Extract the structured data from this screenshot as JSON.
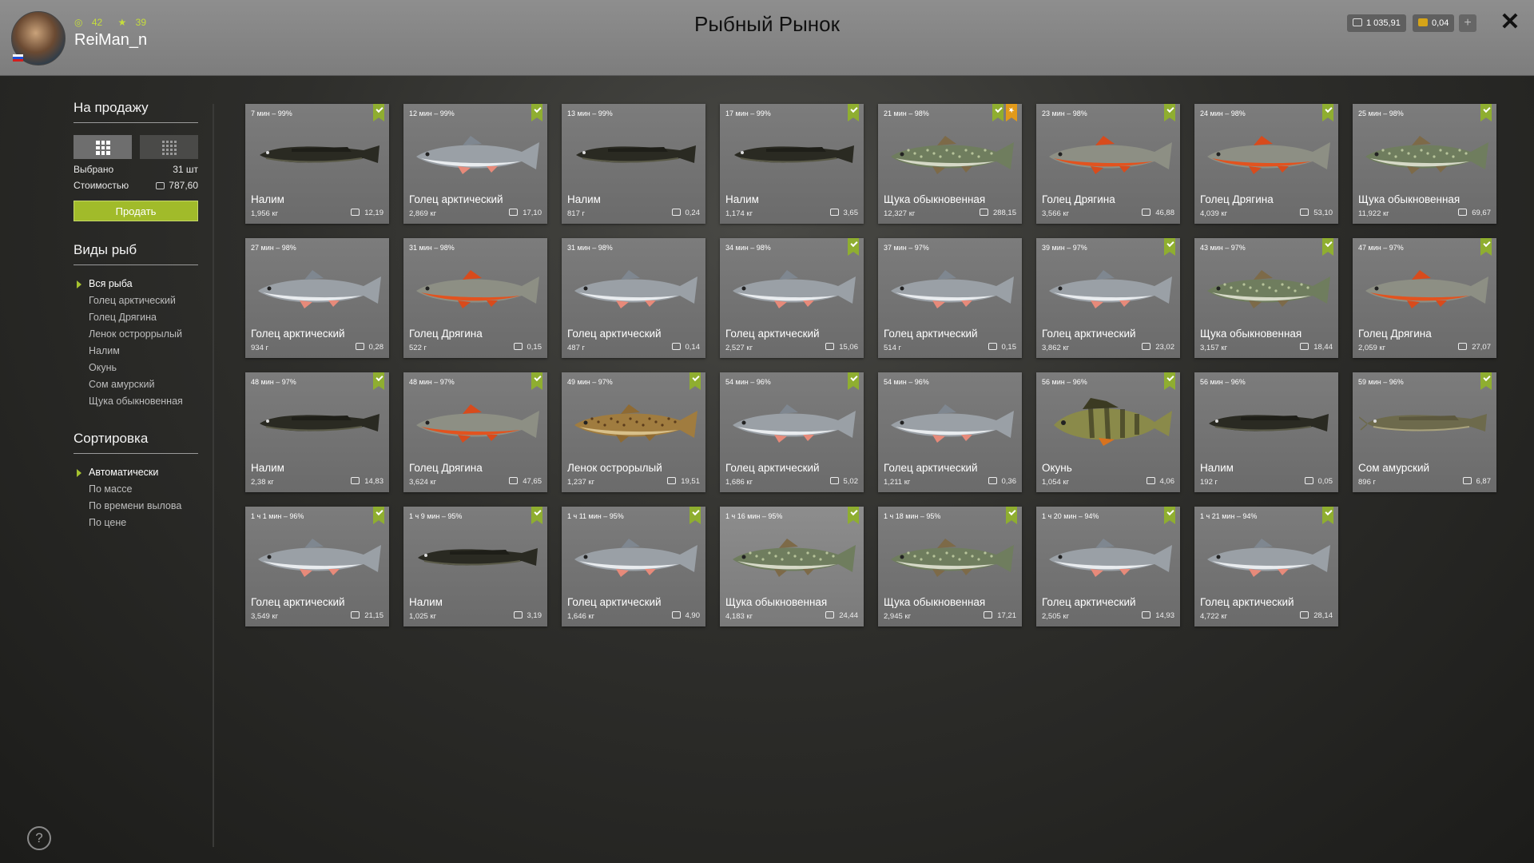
{
  "header": {
    "title": "Рыбный Рынок",
    "username": "ReiMan_n",
    "stat_a": "42",
    "stat_b": "39",
    "silver": "1 035,91",
    "gold": "0,04",
    "plus": "+",
    "close": "✕"
  },
  "sidebar": {
    "for_sale_title": "На продажу",
    "selected_label": "Выбрано",
    "selected_value": "31 шт",
    "cost_label": "Стоимостью",
    "cost_value": "787,60",
    "sell_button": "Продать",
    "species_title": "Виды рыб",
    "species": [
      "Вся рыба",
      "Голец арктический",
      "Голец Дрягина",
      "Ленок остроррылый",
      "Налим",
      "Окунь",
      "Сом амурский",
      "Щука обыкновенная"
    ],
    "sort_title": "Сортировка",
    "sort_options": [
      "Автоматически",
      "По массе",
      "По времени вылова",
      "По цене"
    ]
  },
  "help": "?",
  "colors": {
    "accent": "#a1bb2a",
    "bookmark_green": "#8fae30",
    "bookmark_orange": "#e29a1a",
    "header_bg": "#878787"
  },
  "fish_cards": [
    {
      "time": "7 мин – 99%",
      "name": "Налим",
      "weight": "1,956 кг",
      "price": "12,19",
      "kind": "burbot",
      "marks": [
        "green"
      ]
    },
    {
      "time": "12 мин – 99%",
      "name": "Голец арктический",
      "weight": "2,869 кг",
      "price": "17,10",
      "kind": "char",
      "marks": [
        "green"
      ]
    },
    {
      "time": "13 мин – 99%",
      "name": "Налим",
      "weight": "817 г",
      "price": "0,24",
      "kind": "burbot",
      "marks": []
    },
    {
      "time": "17 мин – 99%",
      "name": "Налим",
      "weight": "1,174 кг",
      "price": "3,65",
      "kind": "burbot",
      "marks": [
        "green"
      ]
    },
    {
      "time": "21 мин – 98%",
      "name": "Щука обыкновенная",
      "weight": "12,327 кг",
      "price": "288,15",
      "kind": "pike",
      "marks": [
        "green",
        "orange"
      ]
    },
    {
      "time": "23 мин – 98%",
      "name": "Голец Дрягина",
      "weight": "3,566 кг",
      "price": "46,88",
      "kind": "redchar",
      "marks": [
        "green"
      ]
    },
    {
      "time": "24 мин – 98%",
      "name": "Голец Дрягина",
      "weight": "4,039 кг",
      "price": "53,10",
      "kind": "redchar",
      "marks": [
        "green"
      ]
    },
    {
      "time": "25 мин – 98%",
      "name": "Щука обыкновенная",
      "weight": "11,922 кг",
      "price": "69,67",
      "kind": "pike",
      "marks": [
        "green"
      ]
    },
    {
      "time": "27 мин – 98%",
      "name": "Голец арктический",
      "weight": "934 г",
      "price": "0,28",
      "kind": "char",
      "marks": []
    },
    {
      "time": "31 мин – 98%",
      "name": "Голец Дрягина",
      "weight": "522 г",
      "price": "0,15",
      "kind": "redchar",
      "marks": []
    },
    {
      "time": "31 мин – 98%",
      "name": "Голец арктический",
      "weight": "487 г",
      "price": "0,14",
      "kind": "char",
      "marks": []
    },
    {
      "time": "34 мин – 98%",
      "name": "Голец арктический",
      "weight": "2,527 кг",
      "price": "15,06",
      "kind": "char",
      "marks": [
        "green"
      ]
    },
    {
      "time": "37 мин – 97%",
      "name": "Голец арктический",
      "weight": "514 г",
      "price": "0,15",
      "kind": "char",
      "marks": []
    },
    {
      "time": "39 мин – 97%",
      "name": "Голец арктический",
      "weight": "3,862 кг",
      "price": "23,02",
      "kind": "char",
      "marks": [
        "green"
      ]
    },
    {
      "time": "43 мин – 97%",
      "name": "Щука обыкновенная",
      "weight": "3,157 кг",
      "price": "18,44",
      "kind": "pike",
      "marks": [
        "green"
      ]
    },
    {
      "time": "47 мин – 97%",
      "name": "Голец Дрягина",
      "weight": "2,059 кг",
      "price": "27,07",
      "kind": "redchar",
      "marks": [
        "green"
      ]
    },
    {
      "time": "48 мин – 97%",
      "name": "Налим",
      "weight": "2,38 кг",
      "price": "14,83",
      "kind": "burbot",
      "marks": [
        "green"
      ]
    },
    {
      "time": "48 мин – 97%",
      "name": "Голец Дрягина",
      "weight": "3,624 кг",
      "price": "47,65",
      "kind": "redchar",
      "marks": [
        "green"
      ]
    },
    {
      "time": "49 мин – 97%",
      "name": "Ленок острорылый",
      "weight": "1,237 кг",
      "price": "19,51",
      "kind": "lenok",
      "marks": [
        "green"
      ]
    },
    {
      "time": "54 мин – 96%",
      "name": "Голец арктический",
      "weight": "1,686 кг",
      "price": "5,02",
      "kind": "char",
      "marks": [
        "green"
      ]
    },
    {
      "time": "54 мин – 96%",
      "name": "Голец арктический",
      "weight": "1,211 кг",
      "price": "0,36",
      "kind": "char",
      "marks": []
    },
    {
      "time": "56 мин – 96%",
      "name": "Окунь",
      "weight": "1,054 кг",
      "price": "4,06",
      "kind": "perch",
      "marks": [
        "green"
      ]
    },
    {
      "time": "56 мин – 96%",
      "name": "Налим",
      "weight": "192 г",
      "price": "0,05",
      "kind": "burbot",
      "marks": []
    },
    {
      "time": "59 мин – 96%",
      "name": "Сом амурский",
      "weight": "896 г",
      "price": "6,87",
      "kind": "catfish",
      "marks": [
        "green"
      ]
    },
    {
      "time": "1 ч 1 мин – 96%",
      "name": "Голец арктический",
      "weight": "3,549 кг",
      "price": "21,15",
      "kind": "char",
      "marks": [
        "green"
      ]
    },
    {
      "time": "1 ч 9 мин – 95%",
      "name": "Налим",
      "weight": "1,025 кг",
      "price": "3,19",
      "kind": "burbot",
      "marks": [
        "green"
      ]
    },
    {
      "time": "1 ч 11 мин – 95%",
      "name": "Голец арктический",
      "weight": "1,646 кг",
      "price": "4,90",
      "kind": "char",
      "marks": [
        "green"
      ]
    },
    {
      "time": "1 ч 16 мин – 95%",
      "name": "Щука обыкновенная",
      "weight": "4,183 кг",
      "price": "24,44",
      "kind": "pike",
      "marks": [
        "green"
      ],
      "dim": true
    },
    {
      "time": "1 ч 18 мин – 95%",
      "name": "Щука обыкновенная",
      "weight": "2,945 кг",
      "price": "17,21",
      "kind": "pike",
      "marks": [
        "green"
      ]
    },
    {
      "time": "1 ч 20 мин – 94%",
      "name": "Голец арктический",
      "weight": "2,505 кг",
      "price": "14,93",
      "kind": "char",
      "marks": [
        "green"
      ]
    },
    {
      "time": "1 ч 21 мин – 94%",
      "name": "Голец арктический",
      "weight": "4,722 кг",
      "price": "28,14",
      "kind": "char",
      "marks": [
        "green"
      ]
    }
  ]
}
